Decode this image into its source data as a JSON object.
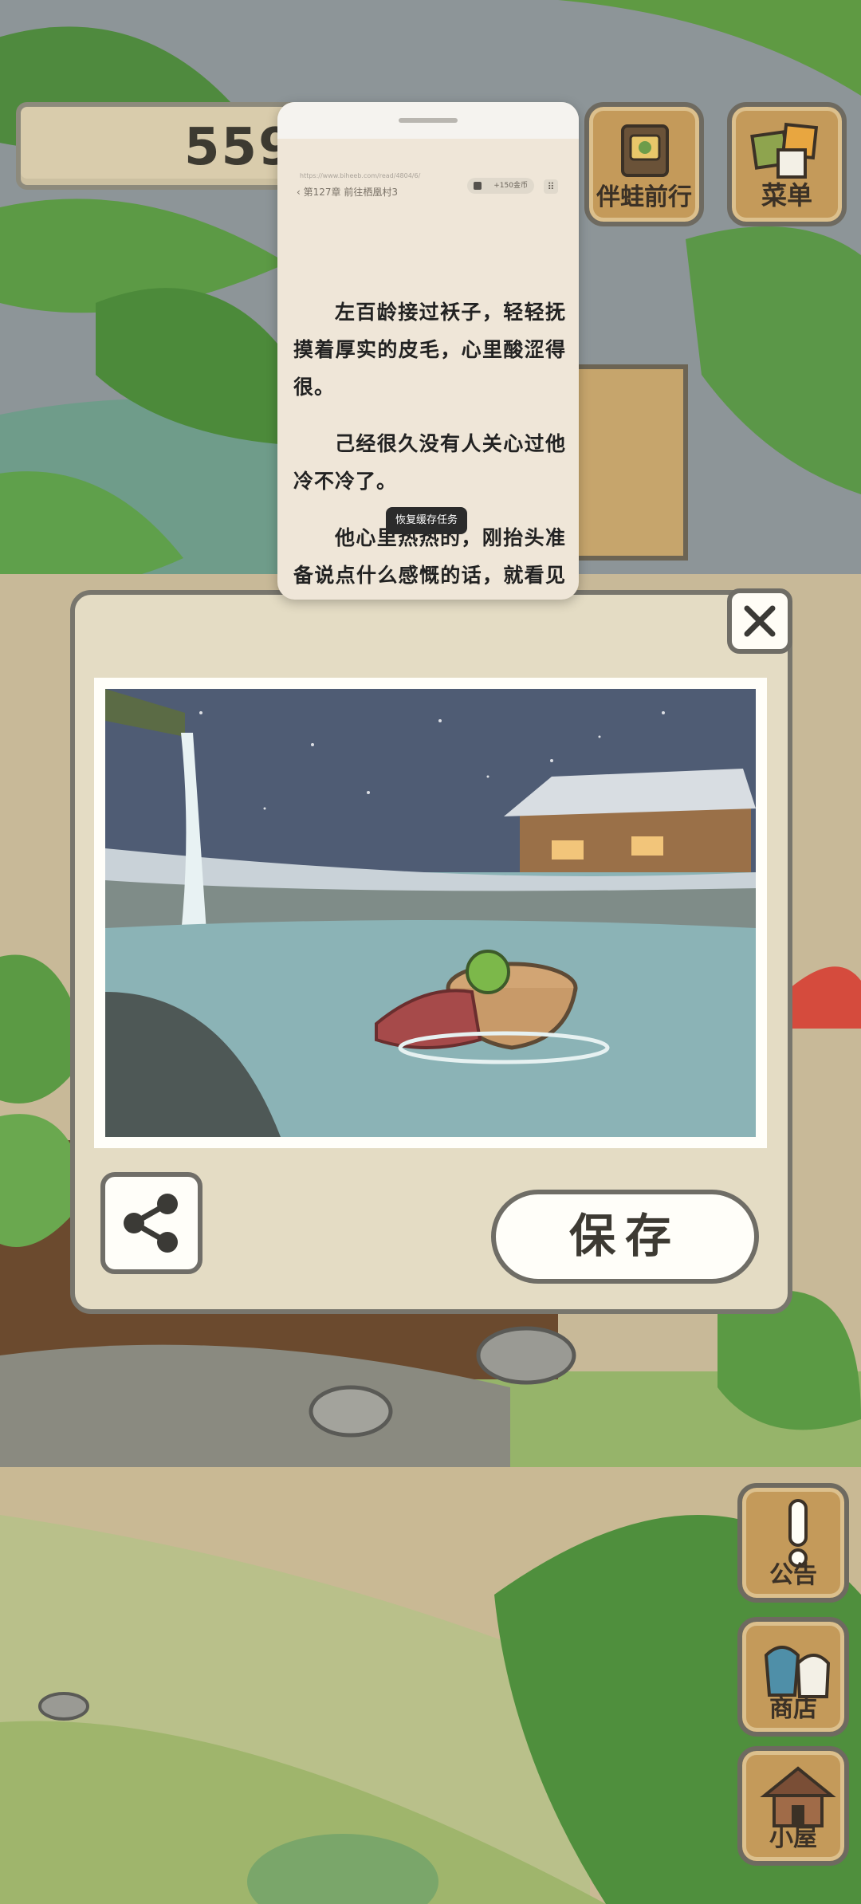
{
  "hud": {
    "clover_count": "559",
    "companion_label": "伴蛙前行",
    "menu_label": "菜单",
    "notice_label": "公告",
    "shop_label": "商店",
    "house_label": "小屋"
  },
  "reader": {
    "url": "https://www.biheeb.com/read/4804/6/",
    "chapter": "第127章 前往栖凰村3",
    "coins": "+150金币",
    "paragraphs": [
      "左百龄接过袄子，轻轻抚摸着厚实的皮毛，心里酸涩得很。",
      "己经很久没有人关心过他冷不冷了。",
      "他心里热热的，刚抬头准备说点什么感慨的话，就看见姜逸之非常妩妩地捂住了自己的耳朵。"
    ],
    "toast": "恢复缓存任务"
  },
  "dialog": {
    "save_label": "保存"
  },
  "colors": {
    "dialog_bg": "#e4dcc4",
    "wood": "#c49a5a",
    "sky": "#4f5c74",
    "water": "#8bb3b6"
  },
  "icons": {
    "close": "close-icon",
    "share": "share-icon"
  }
}
